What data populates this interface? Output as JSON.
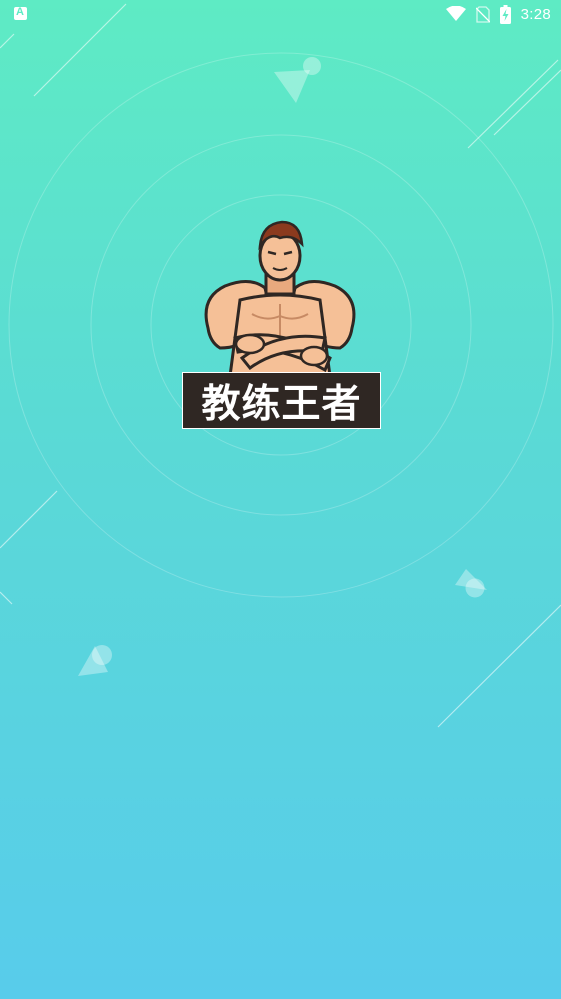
{
  "status_bar": {
    "time": "3:28",
    "icons": [
      "notification-app-icon",
      "wifi-icon",
      "no-sim-icon",
      "battery-charging-icon"
    ]
  },
  "app": {
    "title": "教练王者",
    "logo": "bodybuilder-mascot"
  },
  "colors": {
    "gradient_top": "#5EEBC4",
    "gradient_bottom": "#58CCEB",
    "banner": "#2F2723",
    "skin": "#F5C097",
    "hair": "#8B3A1E"
  }
}
